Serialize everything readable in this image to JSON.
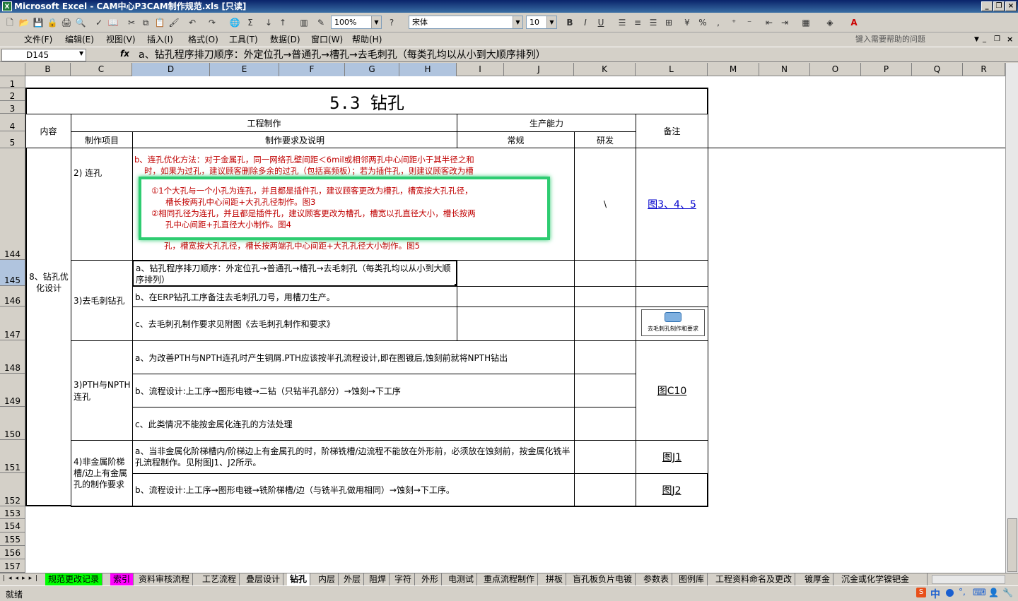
{
  "window": {
    "title": "Microsoft Excel - CAM中心P3CAM制作规范.xls [只读]"
  },
  "toolbar": {
    "zoom": "100%",
    "font": "宋体",
    "font_size": "10",
    "bold": "B",
    "italic": "I",
    "underline": "U",
    "percent": "%",
    "comma": ","
  },
  "menu": {
    "items": [
      "文件(F)",
      "编辑(E)",
      "视图(V)",
      "插入(I)",
      "格式(O)",
      "工具(T)",
      "数据(D)",
      "窗口(W)",
      "帮助(H)"
    ],
    "help_placeholder": "键入需要帮助的问题"
  },
  "formula": {
    "cell_ref": "D145",
    "fx": "fx",
    "content": "a、钻孔程序排刀顺序：外定位孔→普通孔→槽孔→去毛刺孔（每类孔均以从小到大顺序排列）"
  },
  "columns": [
    "B",
    "C",
    "D",
    "E",
    "F",
    "G",
    "H",
    "I",
    "J",
    "K",
    "L",
    "M",
    "N",
    "O",
    "P",
    "Q",
    "R"
  ],
  "rows": [
    "1",
    "2",
    "3",
    "4",
    "5",
    "144",
    "145",
    "146",
    "147",
    "148",
    "149",
    "150",
    "151",
    "152",
    "153",
    "154",
    "155",
    "156",
    "157"
  ],
  "sheet": {
    "title": "5.3 钻孔",
    "h_content": "内容",
    "h_eng": "工程制作",
    "h_cap": "生产能力",
    "h_note": "备注",
    "h_item": "制作项目",
    "h_req": "制作要求及说明",
    "h_normal": "常规",
    "h_rd": "研发",
    "r144_item": "2) 连孔",
    "r144_text1": "b、连孔优化方法：对于金属孔，同一网络孔壁间距＜6mil或相邻两孔中心间距小于其半径之和",
    "r144_text2": "时，如果为过孔，建议顾客删除多余的过孔（包括高频板）；若为插件孔，则建议顾客改为槽",
    "r144_text3": "孔，槽宽按大孔孔径，槽长按两端孔中心间距+大孔孔径大小制作。图5",
    "r144_rd": "\\",
    "r144_note": "图3、4、5",
    "popup1": "①1个大孔与一个小孔为连孔，并且都是插件孔，建议顾客更改为槽孔，槽宽按大孔孔径，",
    "popup2": "槽长按两孔中心间距+大孔孔径制作。图3",
    "popup3": "②相同孔径为连孔，并且都是插件孔，建议顾客更改为槽孔，槽宽以孔直径大小，槽长按两",
    "popup4": "孔中心间距+孔直径大小制作。图4",
    "group8": "8、钻孔优化设计",
    "r_deburr_item": "3)去毛刺钻孔",
    "r145_text": "a、钻孔程序排刀顺序：外定位孔→普通孔→槽孔→去毛刺孔（每类孔均以从小到大顺序排列）",
    "r146_text": "b、在ERP钻孔工序备注去毛刺孔刀号，用槽刀生产。",
    "r147_text": "c、去毛刺孔制作要求见附图《去毛刺孔制作和要求》",
    "r147_obj_label": "去毛刺孔制作和要求",
    "r_pth_item": "3)PTH与NPTH连孔",
    "r148_text": "a、为改善PTH与NPTH连孔时产生铜屑.PTH应该按半孔流程设计,即在图镀后,蚀刻前就将NPTH钻出",
    "r149_text": "b、流程设计:上工序→图形电镀→二钻（只钻半孔部分）→蚀刻→下工序",
    "r150_text": "c、此类情况不能按金属化连孔的方法处理",
    "r_pth_note": "图C10",
    "r_step_item": "4)非金属阶梯槽/边上有金属孔的制作要求",
    "r151_text": "a、当非金属化阶梯槽内/阶梯边上有金属孔的时，阶梯铣槽/边流程不能放在外形前，必须放在蚀刻前，按金属化铣半孔流程制作。见附图J1、J2所示。",
    "r151_note": "图J1",
    "r152_text": "b、流程设计:上工序→图形电镀→铣阶梯槽/边（与铣半孔做用相同）→蚀刻→下工序。",
    "r152_note": "图J2"
  },
  "tabs": [
    "规范更改记录",
    "索引",
    "资料审核流程",
    "工艺流程",
    "叠层设计",
    "钻孔",
    "内层",
    "外层",
    "阻焊",
    "字符",
    "外形",
    "电测试",
    "重点流程制作",
    "拼板",
    "盲孔板负片电镀",
    "参数表",
    "图例库",
    "工程资料命名及更改",
    "镀厚金",
    "沉金或化学镍钯金"
  ],
  "status": {
    "text": "就绪",
    "ime": "中"
  },
  "colors": {
    "tab_green": "#00ff00",
    "tab_magenta": "#ff00ff",
    "red_text": "#c00000",
    "popup_border": "#2ecc71"
  }
}
